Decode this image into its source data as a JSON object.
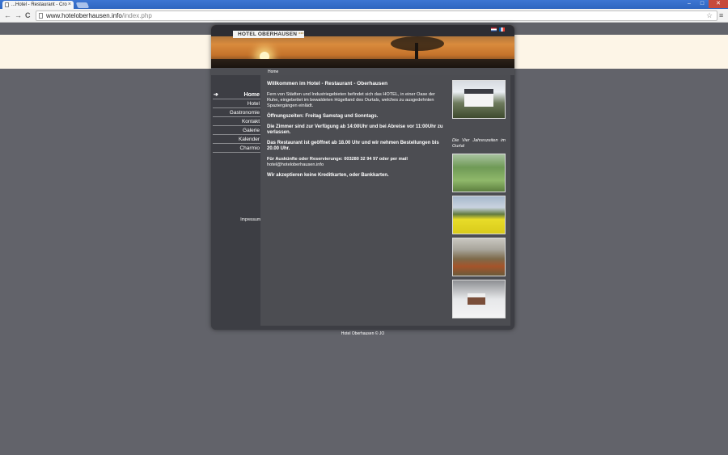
{
  "browser": {
    "tab_title": "...Hotel - Restaurant - Cro",
    "tab_close": "×",
    "url_host": "www.hoteloberhausen.info",
    "url_path": "/index.php",
    "back": "←",
    "forward": "→",
    "reload": "C",
    "star": "☆",
    "menu": "≡",
    "minimize": "–",
    "maximize": "□",
    "close": "✕"
  },
  "site": {
    "logo": "HOTEL OBERHAUSEN",
    "logo_stars": "***",
    "breadcrumb": "Home",
    "nav": [
      {
        "label": "Home",
        "active": true
      },
      {
        "label": "Hotel"
      },
      {
        "label": "Gastronomie"
      },
      {
        "label": "Kontakt"
      },
      {
        "label": "Galerie"
      },
      {
        "label": "Kalender"
      },
      {
        "label": "Charmio"
      }
    ],
    "nav_arrow": "➔",
    "impressum": "Impressum",
    "content": {
      "heading": "Willkommen im Hotel - Restaurant - Oberhausen",
      "intro": "Fern von Städten und Industriegebieten befindet sich das HOTEL, in einer Oase der Ruhe, eingebettet im bewaldeten Hügelland des Ourtals, welches zu ausgedehnten Spaziergängen einlädt.",
      "hours": "Öffnungszeiten: Freitag Samstag und Sonntags.",
      "rooms": "Die Zimmer sind zur Verfügung ab 14:00Uhr und bei Abreise vor 11:00Uhr zu verlassen.",
      "restaurant": "Das Restaurant ist geöffnet ab 18.00 Uhr und wir nehmen Bestellungen bis 20.00 Uhr.",
      "contact_line": "Für Auskünfte oder Reservierunge: 003280 32 94 97 oder per mail",
      "email": "hotel@hoteloberhausen.info",
      "cards": "Wir akzeptieren keine Kreditkarten, oder Bankkarten."
    },
    "photo_caption": "Die Vier Jahreszeiten im Ourtal",
    "footer": "Hotel Oberhausen © JO"
  }
}
